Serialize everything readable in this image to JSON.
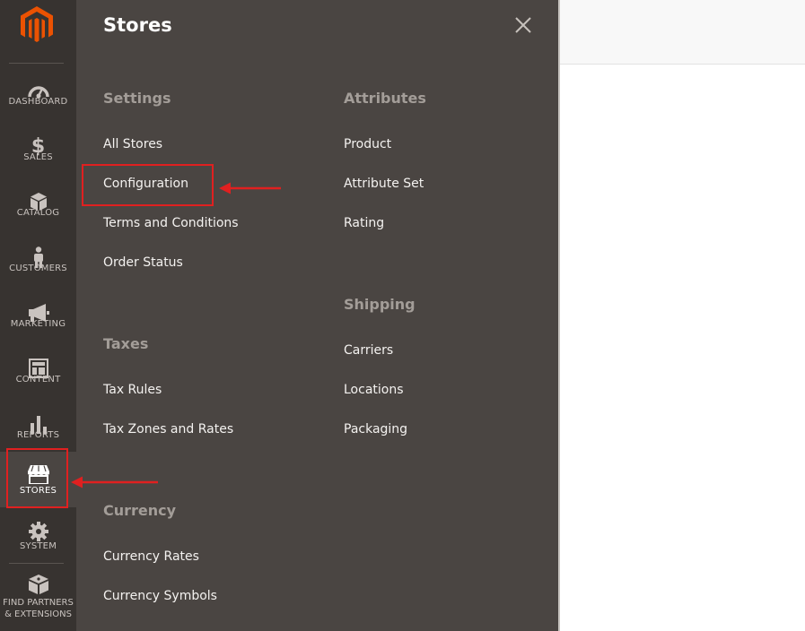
{
  "sidebar": {
    "logo_icon": "magento-logo",
    "items": [
      {
        "label": "DASHBOARD",
        "icon": "dashboard-icon"
      },
      {
        "label": "SALES",
        "icon": "dollar-icon"
      },
      {
        "label": "CATALOG",
        "icon": "box-icon"
      },
      {
        "label": "CUSTOMERS",
        "icon": "person-icon"
      },
      {
        "label": "MARKETING",
        "icon": "megaphone-icon"
      },
      {
        "label": "CONTENT",
        "icon": "layout-icon"
      },
      {
        "label": "REPORTS",
        "icon": "bar-chart-icon"
      },
      {
        "label": "STORES",
        "icon": "storefront-icon"
      },
      {
        "label": "SYSTEM",
        "icon": "gear-icon"
      }
    ],
    "partners": {
      "line1": "FIND PARTNERS",
      "line2": "& EXTENSIONS",
      "icon": "blocks-icon"
    },
    "active": "STORES"
  },
  "panel": {
    "title": "Stores",
    "close_icon": "close-icon",
    "sections": {
      "settings": {
        "title": "Settings",
        "links": [
          "All Stores",
          "Configuration",
          "Terms and Conditions",
          "Order Status"
        ]
      },
      "taxes": {
        "title": "Taxes",
        "links": [
          "Tax Rules",
          "Tax Zones and Rates"
        ]
      },
      "currency": {
        "title": "Currency",
        "links": [
          "Currency Rates",
          "Currency Symbols"
        ]
      },
      "attributes": {
        "title": "Attributes",
        "links": [
          "Product",
          "Attribute Set",
          "Rating"
        ]
      },
      "shipping": {
        "title": "Shipping",
        "links": [
          "Carriers",
          "Locations",
          "Packaging"
        ]
      }
    }
  },
  "colors": {
    "sidebar_bg": "#373330",
    "panel_bg": "#4a4542",
    "brand_orange": "#eb5202",
    "annotation_red": "#e02020"
  }
}
